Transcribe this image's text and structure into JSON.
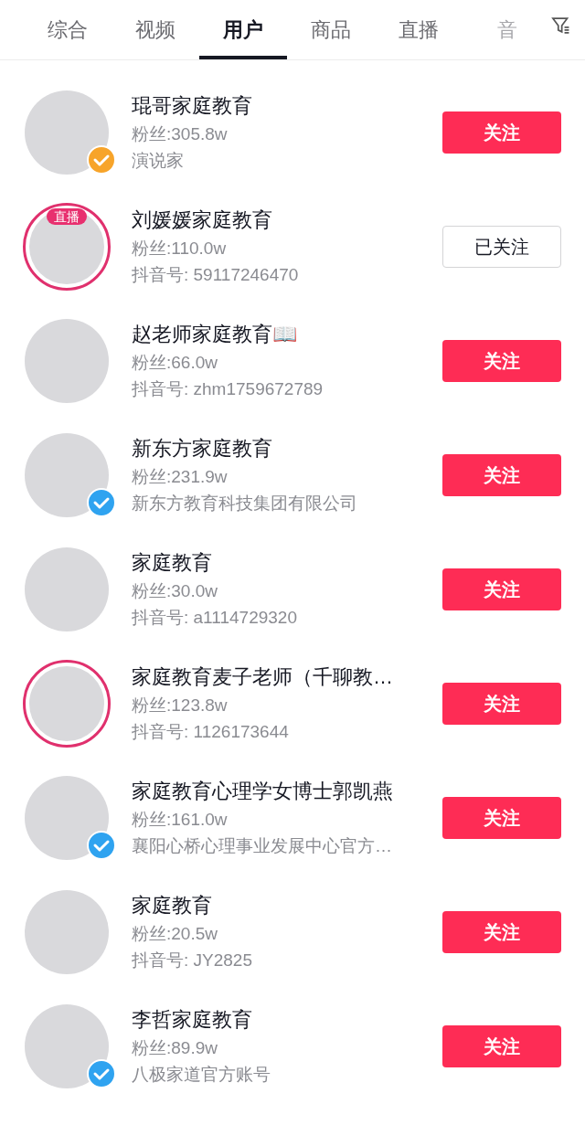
{
  "tabs": [
    {
      "label": "综合",
      "selected": false
    },
    {
      "label": "视频",
      "selected": false
    },
    {
      "label": "用户",
      "selected": true
    },
    {
      "label": "商品",
      "selected": false
    },
    {
      "label": "直播",
      "selected": false
    },
    {
      "label": "音",
      "selected": false,
      "faded": true
    }
  ],
  "users": [
    {
      "name": "琨哥家庭教育",
      "fans": "粉丝:305.8w",
      "detail": "演说家",
      "verified": true,
      "color": "#f7a42a",
      "ring": false,
      "follow_label": "关注",
      "followed": false
    },
    {
      "name": "刘媛媛家庭教育",
      "fans": "粉丝:110.0w",
      "detail": "抖音号: 59117246470",
      "verified": false,
      "ring": true,
      "live_label": "直播",
      "follow_label": "已关注",
      "followed": true
    },
    {
      "name": "赵老师家庭教育📖",
      "fans": "粉丝:66.0w",
      "detail": "抖音号: zhm1759672789",
      "verified": false,
      "ring": false,
      "follow_label": "关注",
      "followed": false
    },
    {
      "name": "新东方家庭教育",
      "fans": "粉丝:231.9w",
      "detail": "新东方教育科技集团有限公司",
      "verified": true,
      "color": "#2fa3f0",
      "ring": false,
      "follow_label": "关注",
      "followed": false
    },
    {
      "name": "家庭教育",
      "fans": "粉丝:30.0w",
      "detail": "抖音号: a1114729320",
      "verified": false,
      "ring": false,
      "follow_label": "关注",
      "followed": false
    },
    {
      "name": "家庭教育麦子老师（千聊教…",
      "fans": "粉丝:123.8w",
      "detail": "抖音号: 1126173644",
      "verified": false,
      "ring": true,
      "follow_label": "关注",
      "followed": false
    },
    {
      "name": "家庭教育心理学女博士郭凯燕",
      "fans": "粉丝:161.0w",
      "detail": "襄阳心桥心理事业发展中心官方…",
      "verified": true,
      "color": "#2fa3f0",
      "ring": false,
      "follow_label": "关注",
      "followed": false
    },
    {
      "name": "家庭教育",
      "fans": "粉丝:20.5w",
      "detail": "抖音号: JY2825",
      "verified": false,
      "ring": false,
      "follow_label": "关注",
      "followed": false
    },
    {
      "name": "李哲家庭教育",
      "fans": "粉丝:89.9w",
      "detail": "八极家道官方账号",
      "verified": true,
      "color": "#2fa3f0",
      "ring": false,
      "follow_label": "关注",
      "followed": false
    }
  ]
}
